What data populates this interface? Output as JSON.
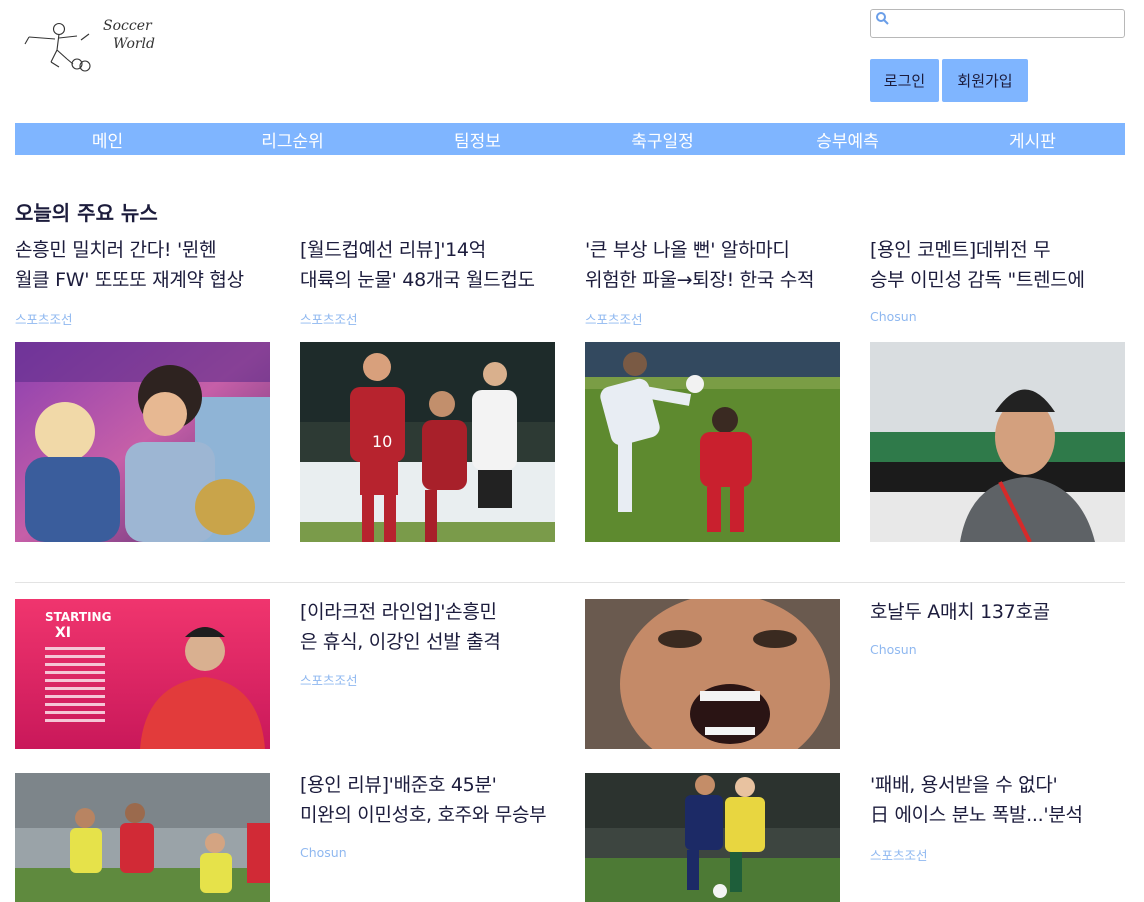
{
  "logo": {
    "text_line1": "Soccer",
    "text_line2": "World"
  },
  "search": {
    "placeholder": "",
    "value": ""
  },
  "auth": {
    "login_label": "로그인",
    "signup_label": "회원가입"
  },
  "nav": {
    "items": [
      "메인",
      "리그순위",
      "팀정보",
      "축구일정",
      "승부예측",
      "게시판"
    ]
  },
  "news": {
    "section_title": "오늘의 주요 뉴스",
    "top": [
      {
        "title_line1": "손흥민 밀치러 간다! '뮌헨",
        "title_line2": "월클 FW' 또또또 재계약 협상",
        "source": "스포츠조선"
      },
      {
        "title_line1": "[월드컵예선 리뷰]'14억",
        "title_line2": "대륙의 눈물' 48개국 월드컵도",
        "source": "스포츠조선"
      },
      {
        "title_line1": "'큰 부상 나올 뻔' 알하마디",
        "title_line2": "위험한 파울→퇴장! 한국 수적",
        "source": "스포츠조선"
      },
      {
        "title_line1": "[용인 코멘트]데뷔전 무",
        "title_line2": "승부 이민성 감독 \"트렌드에",
        "source": "Chosun"
      }
    ],
    "row2": [
      {
        "title_line1": "[이라크전 라인업]'손흥민",
        "title_line2": "은 휴식, 이강인 선발 출격",
        "source": "스포츠조선"
      },
      {
        "title_line1": "호날두 A매치 137호골",
        "title_line2": "",
        "source": "Chosun"
      }
    ],
    "row3": [
      {
        "title_line1": "[용인 리뷰]'배준호 45분'",
        "title_line2": "미완의 이민성호, 호주와 무승부",
        "source": "Chosun"
      },
      {
        "title_line1": "'패배, 용서받을 수 없다'",
        "title_line2": "日 에이스 분노 폭발...'분석",
        "source": "스포츠조선"
      }
    ],
    "starting_card": {
      "header_line1": "STARTING",
      "header_line2": "XI"
    },
    "jersey_number": "10"
  },
  "colors": {
    "accent": "#7fb5ff",
    "title": "#1c1c3c",
    "source": "#8fb8f0"
  }
}
